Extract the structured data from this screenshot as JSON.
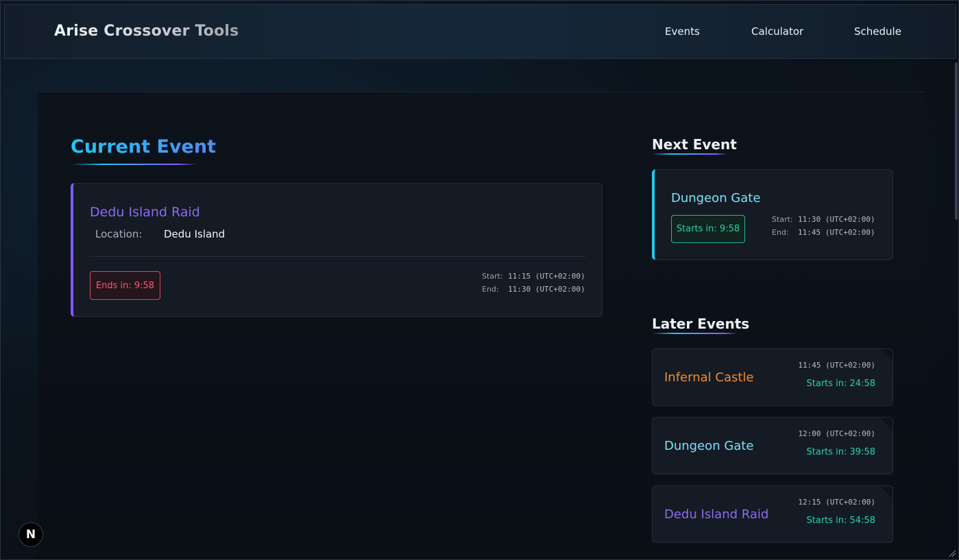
{
  "header": {
    "brand": "Arise Crossover Tools",
    "nav": [
      "Events",
      "Calculator",
      "Schedule"
    ]
  },
  "current": {
    "heading": "Current Event",
    "event": {
      "name": "Dedu Island Raid",
      "location_label": "Location:",
      "location": "Dedu Island",
      "badge": "Ends in: 9:58",
      "start_label": "Start:",
      "start": "11:15 (UTC+02:00)",
      "end_label": "End:",
      "end": "11:30 (UTC+02:00)"
    }
  },
  "next": {
    "heading": "Next Event",
    "event": {
      "name": "Dungeon Gate",
      "badge": "Starts in: 9:58",
      "start_label": "Start:",
      "start": "11:30 (UTC+02:00)",
      "end_label": "End:",
      "end": "11:45 (UTC+02:00)"
    }
  },
  "later": {
    "heading": "Later Events",
    "items": [
      {
        "name": "Infernal Castle",
        "time": "11:45 (UTC+02:00)",
        "starts": "Starts in: 24:58",
        "color": "#f28a2e"
      },
      {
        "name": "Dungeon Gate",
        "time": "12:00 (UTC+02:00)",
        "starts": "Starts in: 39:58",
        "color": "#7fe0f8"
      },
      {
        "name": "Dedu Island Raid",
        "time": "12:15 (UTC+02:00)",
        "starts": "Starts in: 54:58",
        "color": "#8a6cf3"
      }
    ]
  },
  "dev_badge": "N",
  "colors": {
    "accent_cyan": "#22c6f3",
    "accent_purple": "#7b5cf0",
    "danger": "#ff5571",
    "success": "#27d3ac"
  }
}
